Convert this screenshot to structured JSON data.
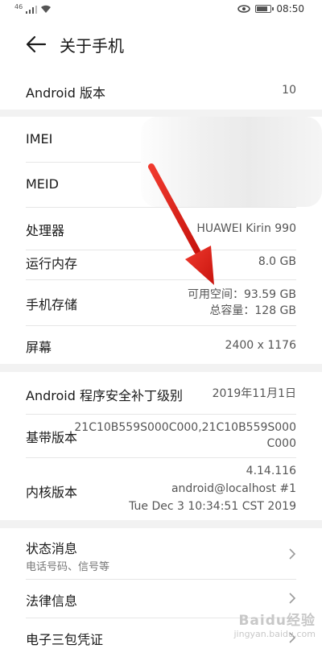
{
  "status_bar": {
    "signal_text": "46",
    "time": "08:50"
  },
  "header": {
    "title": "关于手机"
  },
  "rows": {
    "android_version": {
      "label": "Android 版本",
      "value": "10"
    },
    "imei": {
      "label": "IMEI"
    },
    "meid": {
      "label": "MEID"
    },
    "processor": {
      "label": "处理器",
      "value": "HUAWEI Kirin 990"
    },
    "ram": {
      "label": "运行内存",
      "value": "8.0 GB"
    },
    "storage": {
      "label": "手机存储",
      "available": "可用空间：93.59  GB",
      "total": "总容量：128  GB"
    },
    "screen": {
      "label": "屏幕",
      "value": "2400 x 1176"
    },
    "security_patch": {
      "label": "Android 程序安全补丁级别",
      "value": "2019年11月1日"
    },
    "baseband": {
      "label": "基带版本",
      "value_line1": "21C10B559S000C000,21C10B559S000",
      "value_line2": "C000"
    },
    "kernel": {
      "label": "内核版本",
      "line1": "4.14.116",
      "line2": "android@localhost #1",
      "line3": "Tue Dec 3 10:34:51 CST 2019"
    },
    "status_info": {
      "label": "状态消息",
      "sub": "电话号码、信号等"
    },
    "legal": {
      "label": "法律信息"
    },
    "warranty": {
      "label": "电子三包凭证"
    }
  },
  "watermark": {
    "brand": "Baidu经验",
    "url": "jingyan.baidu.com"
  },
  "colors": {
    "arrow": "#e8201a",
    "background": "#f2f2f2",
    "card": "#ffffff"
  }
}
